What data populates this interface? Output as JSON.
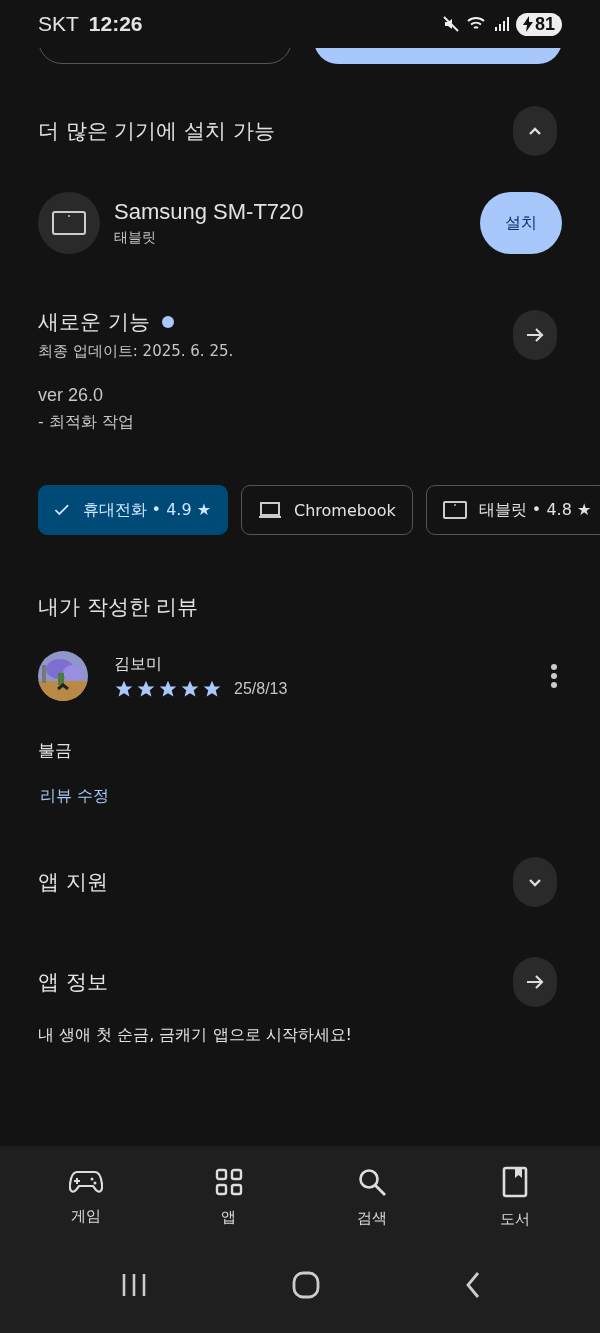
{
  "status_bar": {
    "carrier": "SKT",
    "time": "12:26",
    "battery": "81"
  },
  "install_section": {
    "title": "더 많은 기기에 설치 가능",
    "expanded": true,
    "devices": [
      {
        "name": "Samsung SM-T720",
        "type": "태블릿",
        "button": "설치"
      }
    ]
  },
  "whats_new": {
    "title": "새로운 기능",
    "new_badge": true,
    "updated": "최종 업데이트: 2025. 6. 25.",
    "lines": [
      "ver 26.0",
      "- 최적화 작업"
    ]
  },
  "device_chips": [
    {
      "label": "휴대전화 • 4.9 ★",
      "selected": true
    },
    {
      "kind": "laptop",
      "label": "Chromebook",
      "selected": false
    },
    {
      "kind": "tablet",
      "label": "태블릿 • 4.8 ★",
      "selected": false
    }
  ],
  "my_review": {
    "title": "내가 작성한 리뷰",
    "author": "김보미",
    "stars": 5,
    "date": "25/8/13",
    "text": "불금",
    "edit_link": "리뷰 수정"
  },
  "sections": [
    {
      "kind": "expand",
      "title": "앱 지원",
      "expanded": false
    },
    {
      "kind": "link",
      "title": "앱 정보",
      "description": "내 생애 첫 순금, 금캐기 앱으로 시작하세요!"
    }
  ],
  "bottom_nav": [
    {
      "kind": "game",
      "label": "게임"
    },
    {
      "kind": "apps",
      "label": "앱"
    },
    {
      "kind": "search",
      "label": "검색"
    },
    {
      "kind": "book",
      "label": "도서"
    }
  ]
}
